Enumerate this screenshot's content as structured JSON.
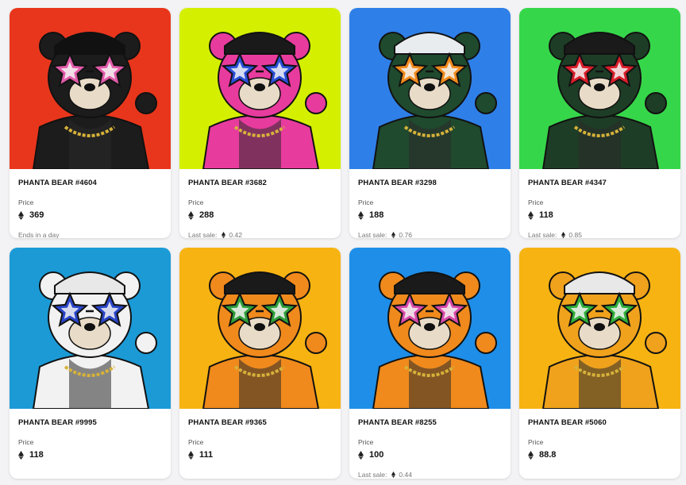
{
  "colors": {
    "eth_icon": "#222222",
    "page_background": "#f3f3f5"
  },
  "cards": [
    {
      "name": "PHANTA BEAR #4604",
      "price_label": "Price",
      "price": "369",
      "footer_text": "Ends in a day",
      "last_sale": "",
      "background": "#e8361c",
      "bear_color": "#1c1c1c",
      "glasses_color": "#e05aa8",
      "hat_color": "#111111",
      "icon": "eth-icon"
    },
    {
      "name": "PHANTA BEAR #3682",
      "price_label": "Price",
      "price": "288",
      "footer_text": "Last sale:",
      "last_sale": "0.42",
      "background": "#d4f000",
      "bear_color": "#e83b9e",
      "glasses_color": "#2b4fd8",
      "hat_color": "#1a1a1a",
      "icon": "eth-icon"
    },
    {
      "name": "PHANTA BEAR #3298",
      "price_label": "Price",
      "price": "188",
      "footer_text": "Last sale:",
      "last_sale": "0.76",
      "background": "#2f7fe8",
      "bear_color": "#1f4a2e",
      "glasses_color": "#f08a1c",
      "hat_color": "#e9ecef",
      "icon": "eth-icon"
    },
    {
      "name": "PHANTA BEAR #4347",
      "price_label": "Price",
      "price": "118",
      "footer_text": "Last sale:",
      "last_sale": "0.85",
      "background": "#36d64a",
      "bear_color": "#1e3d26",
      "glasses_color": "#d81e2a",
      "hat_color": "#1a1a1a",
      "icon": "eth-icon"
    },
    {
      "name": "PHANTA BEAR #9995",
      "price_label": "Price",
      "price": "118",
      "footer_text": "",
      "last_sale": "",
      "background": "#1b9ad6",
      "bear_color": "#f2f2f2",
      "glasses_color": "#2a45c8",
      "hat_color": "#e8e8e8",
      "icon": "eth-icon"
    },
    {
      "name": "PHANTA BEAR #9365",
      "price_label": "Price",
      "price": "111",
      "footer_text": "",
      "last_sale": "",
      "background": "#f6b312",
      "bear_color": "#f08a1c",
      "glasses_color": "#2f9e3a",
      "hat_color": "#1a1a1a",
      "icon": "eth-icon"
    },
    {
      "name": "PHANTA BEAR #8255",
      "price_label": "Price",
      "price": "100",
      "footer_text": "Last sale:",
      "last_sale": "0.44",
      "background": "#1e8ee8",
      "bear_color": "#f08a1c",
      "glasses_color": "#d84aa8",
      "hat_color": "#1a1a1a",
      "icon": "eth-icon"
    },
    {
      "name": "PHANTA BEAR #5060",
      "price_label": "Price",
      "price": "88.8",
      "footer_text": "",
      "last_sale": "",
      "background": "#f6b312",
      "bear_color": "#f0a21c",
      "glasses_color": "#2fae3a",
      "hat_color": "#e8e8e8",
      "icon": "eth-icon"
    }
  ]
}
